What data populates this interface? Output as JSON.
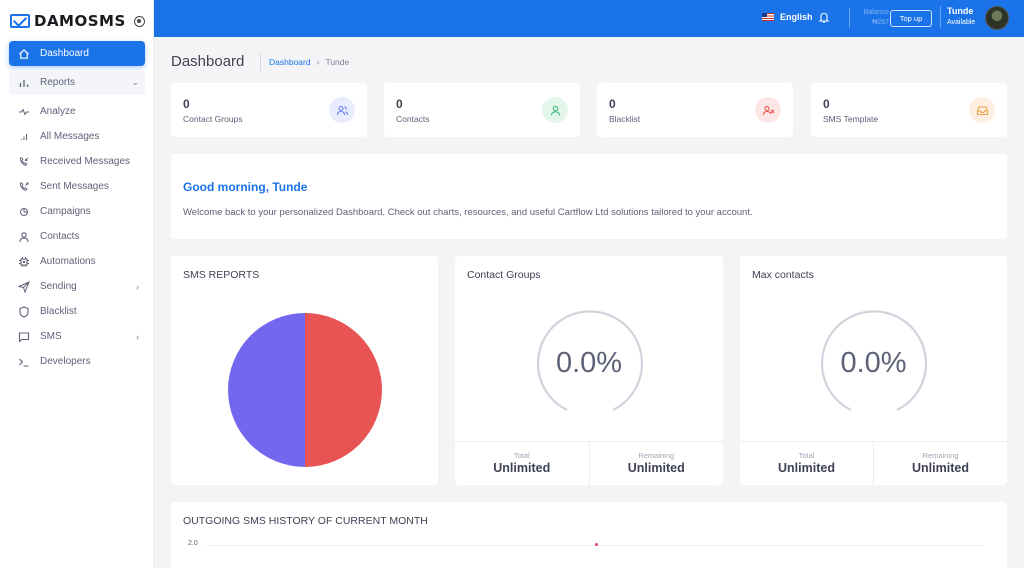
{
  "brand": {
    "name": "DAMOSMS"
  },
  "sidebar": {
    "items": [
      {
        "label": "Dashboard",
        "icon": "home-icon"
      },
      {
        "label": "Reports",
        "icon": "bar-chart-icon"
      },
      {
        "label": "Analyze",
        "icon": "pulse-icon"
      },
      {
        "label": "All Messages",
        "icon": "signal-icon"
      },
      {
        "label": "Received Messages",
        "icon": "phone-incoming-icon"
      },
      {
        "label": "Sent Messages",
        "icon": "phone-outgoing-icon"
      },
      {
        "label": "Campaigns",
        "icon": "pie-icon"
      },
      {
        "label": "Contacts",
        "icon": "user-icon"
      },
      {
        "label": "Automations",
        "icon": "chip-icon"
      },
      {
        "label": "Sending",
        "icon": "send-icon"
      },
      {
        "label": "Blacklist",
        "icon": "shield-icon"
      },
      {
        "label": "SMS",
        "icon": "message-icon"
      },
      {
        "label": "Developers",
        "icon": "terminal-icon"
      }
    ]
  },
  "header": {
    "language": "English",
    "balance_label": "Balance",
    "balance_value": "₦267",
    "topup_label": "Top up",
    "user_name": "Tunde",
    "user_status": "Available"
  },
  "page": {
    "title": "Dashboard",
    "breadcrumb": {
      "link": "Dashboard",
      "current": "Tunde"
    }
  },
  "stats": [
    {
      "value": "0",
      "label": "Contact Groups",
      "color": "#6e7ff3",
      "bg": "#e9ecfd"
    },
    {
      "value": "0",
      "label": "Contacts",
      "color": "#3fbf7f",
      "bg": "#e4f6ec"
    },
    {
      "value": "0",
      "label": "Blacklist",
      "color": "#e5534b",
      "bg": "#fce7e6"
    },
    {
      "value": "0",
      "label": "SMS Template",
      "color": "#f0a04b",
      "bg": "#fdf0e2"
    }
  ],
  "greeting": {
    "title": "Good morning, Tunde",
    "text": "Welcome back to your personalized Dashboard. Check out charts, resources, and useful Cartflow Ltd solutions tailored to your account."
  },
  "sms_reports": {
    "title": "SMS REPORTS"
  },
  "contact_groups": {
    "title": "Contact Groups",
    "percent": "0.0%",
    "total_label": "Total",
    "total_value": "Unlimited",
    "remaining_label": "Remaining",
    "remaining_value": "Unlimited"
  },
  "max_contacts": {
    "title": "Max contacts",
    "percent": "0.0%",
    "total_label": "Total",
    "total_value": "Unlimited",
    "remaining_label": "Remaining",
    "remaining_value": "Unlimited"
  },
  "history": {
    "title": "OUTGOING SMS HISTORY OF CURRENT MONTH",
    "y_tick": "2.0"
  },
  "chart_data": {
    "type": "pie",
    "values": [
      50,
      50
    ],
    "colors": [
      "#e85353",
      "#7367f0"
    ]
  },
  "colors": {
    "primary": "#1a73e8"
  }
}
